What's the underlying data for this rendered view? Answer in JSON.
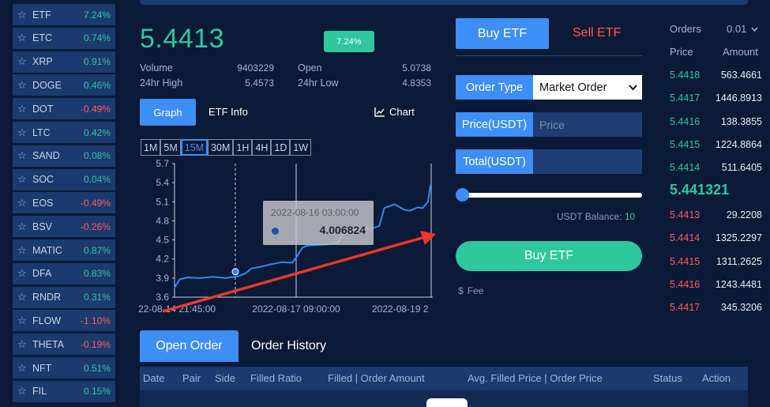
{
  "sidebar": {
    "items": [
      {
        "symbol": "ETF",
        "change": "7.24%",
        "dir": "up"
      },
      {
        "symbol": "ETC",
        "change": "0.74%",
        "dir": "up"
      },
      {
        "symbol": "XRP",
        "change": "0.91%",
        "dir": "up"
      },
      {
        "symbol": "DOGE",
        "change": "0.46%",
        "dir": "up"
      },
      {
        "symbol": "DOT",
        "change": "-0.49%",
        "dir": "down"
      },
      {
        "symbol": "LTC",
        "change": "0.42%",
        "dir": "up"
      },
      {
        "symbol": "SAND",
        "change": "0.08%",
        "dir": "up"
      },
      {
        "symbol": "SOC",
        "change": "0.04%",
        "dir": "up"
      },
      {
        "symbol": "EOS",
        "change": "-0.49%",
        "dir": "down"
      },
      {
        "symbol": "BSV",
        "change": "-0.26%",
        "dir": "down"
      },
      {
        "symbol": "MATIC",
        "change": "0.87%",
        "dir": "up"
      },
      {
        "symbol": "DFA",
        "change": "0.83%",
        "dir": "up"
      },
      {
        "symbol": "RNDR",
        "change": "0.31%",
        "dir": "up"
      },
      {
        "symbol": "FLOW",
        "change": "-1.10%",
        "dir": "down"
      },
      {
        "symbol": "THETA",
        "change": "-0.19%",
        "dir": "down"
      },
      {
        "symbol": "NFT",
        "change": "0.51%",
        "dir": "up"
      },
      {
        "symbol": "FIL",
        "change": "0.15%",
        "dir": "up"
      }
    ]
  },
  "ticker": {
    "price": "5.4413",
    "change_badge": "7.24%",
    "volume_label": "Volume",
    "volume": "9403229",
    "open_label": "Open",
    "open": "5.0738",
    "high_label": "24hr High",
    "high": "5.4573",
    "low_label": "24hr Low",
    "low": "4.8353"
  },
  "chart_tabs": {
    "graph": "Graph",
    "info": "ETF Info",
    "chart": "Chart"
  },
  "timeframes": [
    "1M",
    "5M",
    "15M",
    "30M",
    "1H",
    "4H",
    "1D",
    "1W"
  ],
  "timeframe_active": "15M",
  "chart_data": {
    "type": "line",
    "y_ticks": [
      "5.7",
      "5.4",
      "5.1",
      "4.8",
      "4.5",
      "4.2",
      "3.9",
      "3.6"
    ],
    "ylim": [
      3.6,
      5.7
    ],
    "x_ticks": [
      "22-08-14 21:45:00",
      "2022-08-17 09:00:00",
      "2022-08-19 2"
    ],
    "series": [
      {
        "x": [
          0,
          0.02,
          0.05,
          0.1,
          0.15,
          0.2,
          0.25,
          0.28,
          0.3,
          0.34,
          0.38,
          0.42,
          0.46,
          0.48,
          0.5,
          0.52,
          0.56,
          0.6,
          0.64,
          0.66,
          0.7,
          0.74,
          0.78,
          0.8,
          0.82,
          0.86,
          0.9,
          0.92,
          0.95,
          0.97,
          0.99,
          1.0
        ],
        "values": [
          3.75,
          3.88,
          3.91,
          3.9,
          3.92,
          3.9,
          3.93,
          3.98,
          4.05,
          4.08,
          4.12,
          4.15,
          4.14,
          4.25,
          4.38,
          4.41,
          4.42,
          4.43,
          4.46,
          4.6,
          4.66,
          4.67,
          4.69,
          4.72,
          5.0,
          5.06,
          4.97,
          4.96,
          5.01,
          5.0,
          5.1,
          5.36
        ]
      }
    ],
    "tooltip": {
      "date": "2022-08-16 03:00:00",
      "value": "4.006824"
    }
  },
  "order_tabs": {
    "open": "Open Order",
    "history": "Order History"
  },
  "order_columns": [
    "Date",
    "Pair",
    "Side",
    "Filled Ratio",
    "Filled | Order Amount",
    "Avg. Filled Price | Order Price",
    "Status",
    "Action"
  ],
  "trade": {
    "buy_tab": "Buy ETF",
    "sell_tab": "Sell ETF",
    "order_type_label": "Order Type",
    "order_type_value": "Market Order",
    "price_label": "Price(USDT)",
    "price_placeholder": "Price",
    "total_label": "Total(USDT)",
    "slider_percent": 0,
    "balance_label": "USDT Balance:",
    "balance_value": "10",
    "buy_button": "Buy ETF",
    "fee_label": "Fee"
  },
  "orderbook": {
    "orders_label": "Orders",
    "precision": "0.01",
    "price_header": "Price",
    "amount_header": "Amount",
    "bids": [
      {
        "price": "5.4418",
        "amount": "563.4661"
      },
      {
        "price": "5.4417",
        "amount": "1446.8913"
      },
      {
        "price": "5.4416",
        "amount": "138.3855"
      },
      {
        "price": "5.4415",
        "amount": "1224.8864"
      },
      {
        "price": "5.4414",
        "amount": "511.6405"
      }
    ],
    "mid_price": "5.441321",
    "asks": [
      {
        "price": "5.4413",
        "amount": "29.2208"
      },
      {
        "price": "5.4414",
        "amount": "1325.2297"
      },
      {
        "price": "5.4415",
        "amount": "1311.2625"
      },
      {
        "price": "5.4416",
        "amount": "1243.4481"
      },
      {
        "price": "5.4417",
        "amount": "345.3206"
      }
    ]
  },
  "colors": {
    "accent": "#3d8ef5",
    "up": "#2ec7a0",
    "down": "#ff5a5a",
    "annotation_arrow": "#e8392f"
  }
}
